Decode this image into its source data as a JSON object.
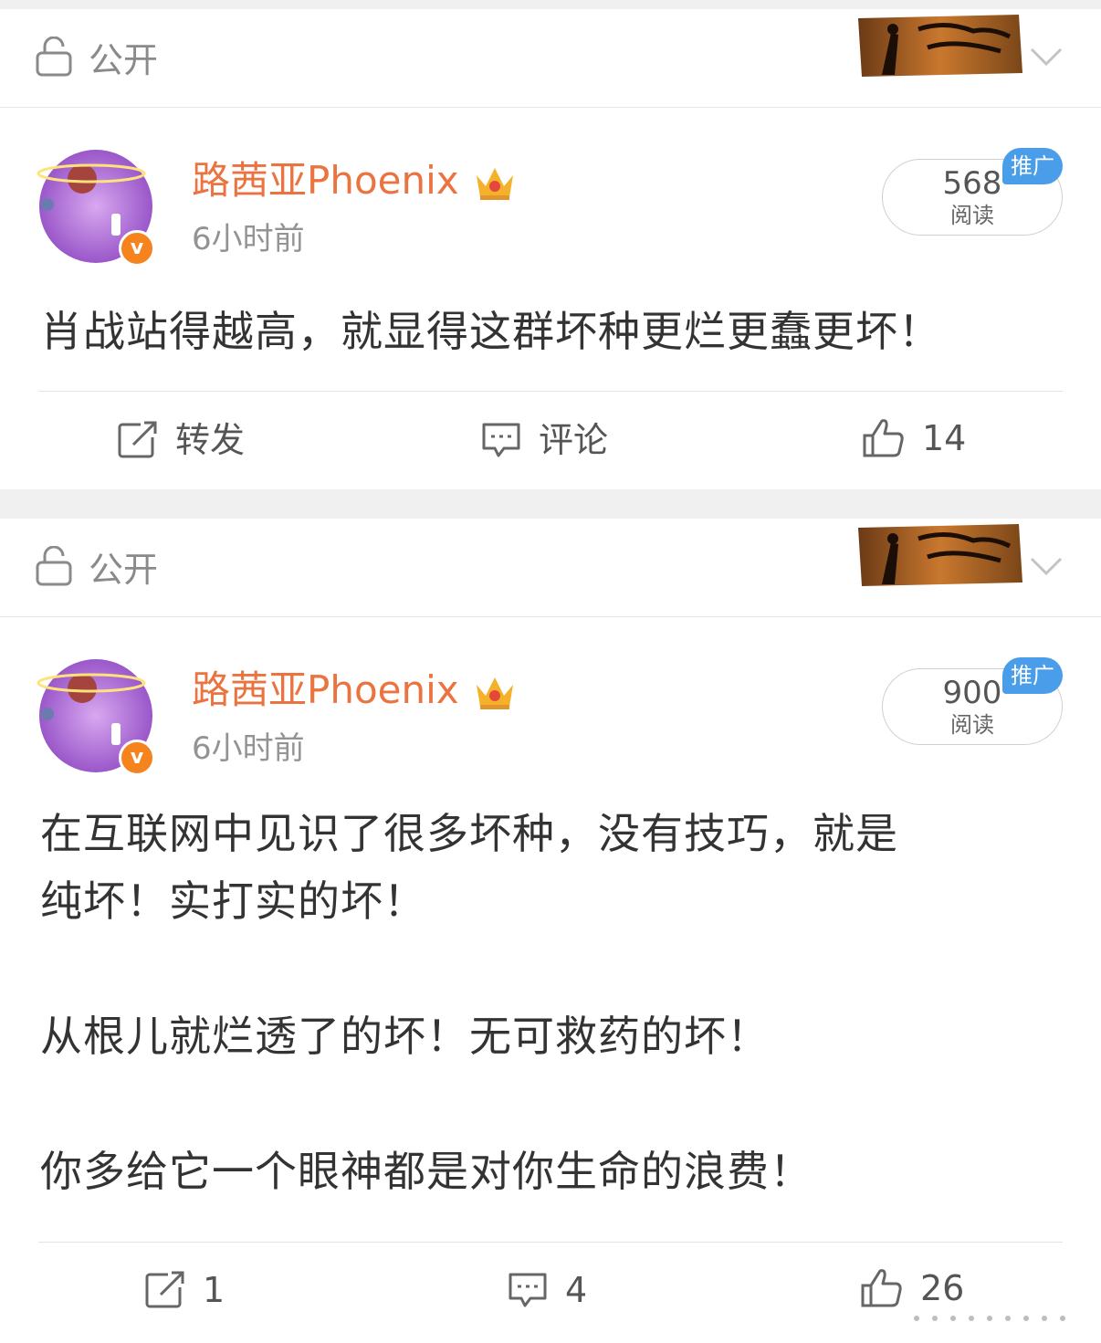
{
  "posts": [
    {
      "visibility": "公开",
      "author": "路茜亚Phoenix",
      "time": "6小时前",
      "reads": "568",
      "reads_label": "阅读",
      "promo": "推广",
      "text": "肖战站得越高，就显得这群坏种更烂更蠢更坏！",
      "actions": {
        "repost": "转发",
        "comment": "评论",
        "like": "14"
      }
    },
    {
      "visibility": "公开",
      "author": "路茜亚Phoenix",
      "time": "6小时前",
      "reads": "900",
      "reads_label": "阅读",
      "promo": "推广",
      "text": "在互联网中见识了很多坏种，没有技巧，就是\n纯坏！实打实的坏！\n\n从根儿就烂透了的坏！无可救药的坏！\n\n你多给它一个眼神都是对你生命的浪费！",
      "actions": {
        "repost": "1",
        "comment": "4",
        "like": "26"
      }
    }
  ],
  "icons": {
    "lock": "lock-icon",
    "banner": "banner-icon",
    "crown": "crown-icon",
    "repost": "repost-icon",
    "comment": "comment-icon",
    "like": "like-icon"
  },
  "colors": {
    "author": "#eb7340",
    "promo": "#4a9de8",
    "verified": "#f5841f",
    "secondary": "#939393"
  }
}
